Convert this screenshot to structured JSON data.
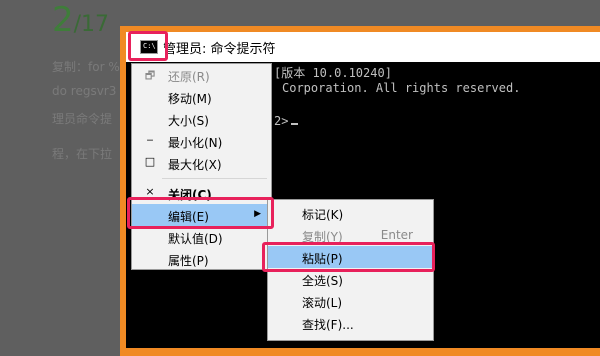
{
  "article": {
    "step_number": "2",
    "step_total": "/17",
    "lines": [
      "复制：for %1",
      "do regsvr3",
      "理员命令提",
      "程，在下拉"
    ]
  },
  "window": {
    "title": "管理员: 命令提示符",
    "icon_text": "C:\\",
    "console": {
      "line1": "[版本 10.0.10240]",
      "line2": "Corporation. All rights reserved.",
      "prompt": "2>"
    }
  },
  "system_menu": {
    "items": [
      {
        "label": "还原(R)",
        "glyph": "🗗",
        "disabled": true
      },
      {
        "label": "移动(M)",
        "glyph": "",
        "disabled": false
      },
      {
        "label": "大小(S)",
        "glyph": "",
        "disabled": false
      },
      {
        "label": "最小化(N)",
        "glyph": "‒",
        "disabled": false
      },
      {
        "label": "最大化(X)",
        "glyph": "□",
        "disabled": false
      },
      {
        "label": "关闭(C)",
        "glyph": "×",
        "bold": true
      },
      {
        "label": "编辑(E)",
        "glyph": "",
        "active": true,
        "submenu": true
      },
      {
        "label": "默认值(D)",
        "glyph": ""
      },
      {
        "label": "属性(P)",
        "glyph": ""
      }
    ]
  },
  "edit_submenu": {
    "items": [
      {
        "label": "标记(K)",
        "accel": "",
        "disabled": false
      },
      {
        "label": "复制(Y)",
        "accel": "Enter",
        "disabled": true
      },
      {
        "label": "粘贴(P)",
        "accel": "",
        "active": true
      },
      {
        "label": "全选(S)",
        "accel": ""
      },
      {
        "label": "滚动(L)",
        "accel": ""
      },
      {
        "label": "查找(F)...",
        "accel": ""
      }
    ]
  },
  "colors": {
    "frame": "#f08a24",
    "highlight": "#e8215b",
    "menu_hover": "#99c8f5",
    "console_bg": "#000000"
  }
}
